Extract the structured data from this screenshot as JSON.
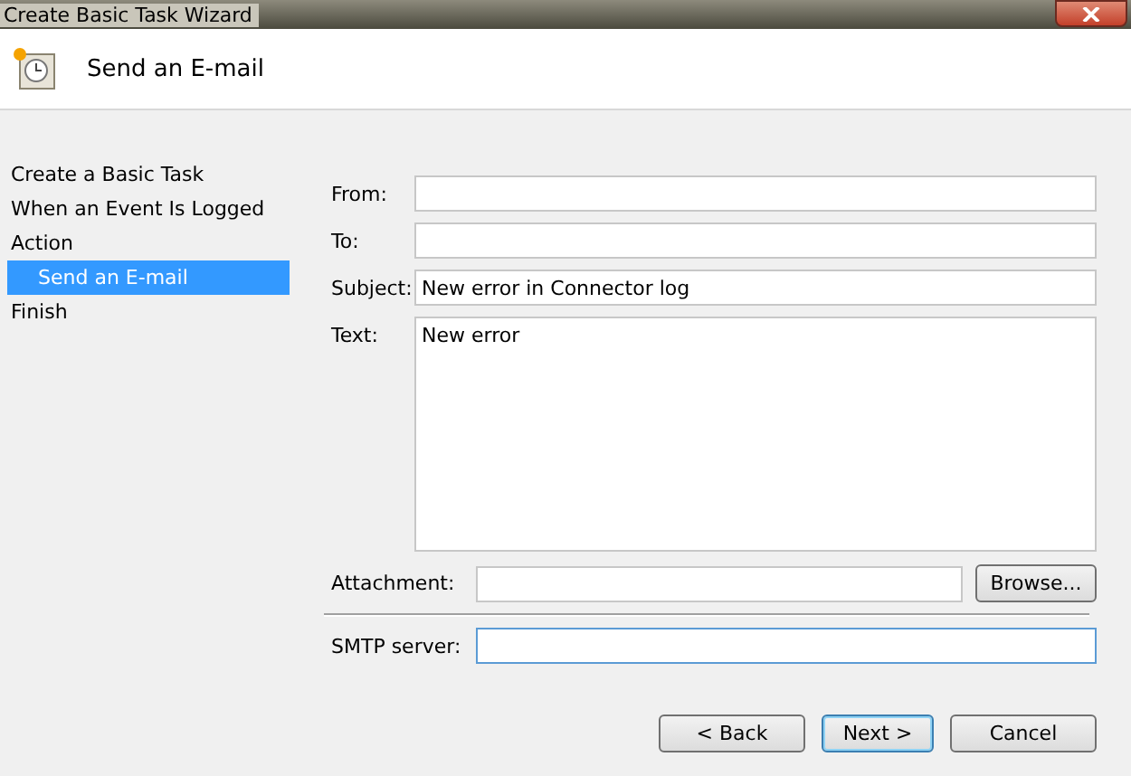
{
  "window": {
    "title": "Create Basic Task Wizard"
  },
  "header": {
    "title": "Send an E-mail"
  },
  "sidebar": {
    "items": [
      {
        "label": "Create a Basic Task",
        "selected": false
      },
      {
        "label": "When an Event Is Logged",
        "selected": false
      },
      {
        "label": "Action",
        "selected": false,
        "children": [
          {
            "label": "Send an E-mail",
            "selected": true
          }
        ]
      },
      {
        "label": "Finish",
        "selected": false
      }
    ]
  },
  "form": {
    "from": {
      "label": "From:"
    },
    "to": {
      "label": "To:"
    },
    "subject": {
      "label": "Subject:",
      "value": "New error in Connector log"
    },
    "text": {
      "label": "Text:",
      "value": "New error"
    },
    "attachment": {
      "label": "Attachment:"
    },
    "browse": "Browse...",
    "smtp": {
      "label": "SMTP server:",
      "focused": true
    }
  },
  "buttons": [
    {
      "label": "< Back",
      "default": false
    },
    {
      "label": "Next >",
      "default": true
    },
    {
      "label": "Cancel",
      "default": false
    }
  ]
}
